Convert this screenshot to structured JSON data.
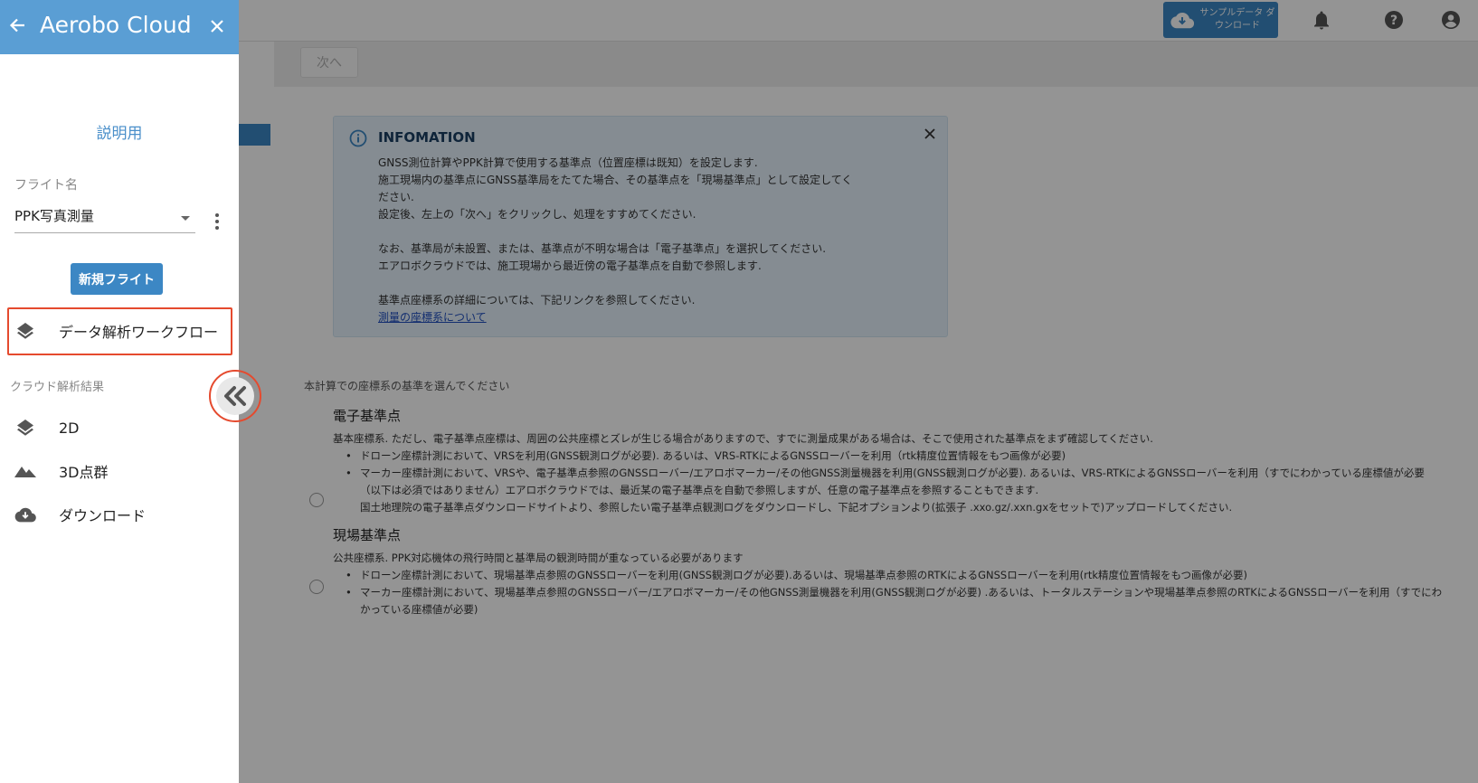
{
  "header": {
    "sample_btn_label": "サンプルデータ ダウンロード",
    "icons": [
      "cloud-download-icon",
      "bell-icon",
      "help-icon",
      "account-icon"
    ]
  },
  "stepbar": {
    "next_label": "次へ"
  },
  "info": {
    "title": "INFOMATION",
    "lines": [
      "GNSS測位計算やPPK計算で使用する基準点（位置座標は既知）を設定します.",
      "施工現場内の基準点にGNSS基準局をたてた場合、その基準点を「現場基準点」として設定してく",
      "ださい.",
      "設定後、左上の「次へ」をクリックし、処理をすすめてください.",
      "なお、基準局が未設置、または、基準点が不明な場合は「電子基準点」を選択してください.",
      "エアロボクラウドでは、施工現場から最近傍の電子基準点を自動で参照します.",
      "基準点座標系の詳細については、下記リンクを参照してください."
    ],
    "link": "測量の座標系について"
  },
  "section": {
    "prompt": "本計算での座標系の基準を選んでください",
    "option1": {
      "title": "電子基準点",
      "desc": "基本座標系. ただし、電子基準点座標は、周囲の公共座標とズレが生じる場合がありますので、すでに測量成果がある場合は、そこで使用された基準点をまず確認してください.",
      "bullets": [
        "ドローン座標計測において、VRSを利用(GNSS観測ログが必要). あるいは、VRS-RTKによるGNSSローバーを利用（rtk精度位置情報をもつ画像が必要)",
        "マーカー座標計測において、VRSや、電子基準点参照のGNSSローバー/エアロボマーカー/その他GNSS測量機器を利用(GNSS観測ログが必要). あるいは、VRS-RTKによるGNSSローバーを利用（すでにわかっている座標値が必要"
      ],
      "sub1": "（以下は必須ではありません）エアロボクラウドでは、最近某の電子基準点を自動で参照しますが、任意の電子基準点を参照することもできます.",
      "sub2": "国土地理院の電子基準点ダウンロードサイトより、参照したい電子基準点観測ログをダウンロードし、下記オプションより(拡張子 .xxo.gz/.xxn.gxをセットで)アップロードしてください."
    },
    "option2": {
      "title": "現場基準点",
      "desc": "公共座標系. PPK対応機体の飛行時間と基準局の観測時間が重なっている必要があります",
      "bullets": [
        "ドローン座標計測において、現場基準点参照のGNSSローバーを利用(GNSS観測ログが必要).あるいは、現場基準点参照のRTKによるGNSSローバーを利用(rtk精度位置情報をもつ画像が必要)",
        "マーカー座標計測において、現場基準点参照のGNSSローバー/エアロボマーカー/その他GNSS測量機器を利用(GNSS観測ログが必要) .あるいは、トータルステーションや現場基準点参照のRTKによるGNSSローバーを利用（すでにわかっている座標値が必要)"
      ]
    }
  },
  "drawer": {
    "title": "Aerobo Cloud",
    "project_name": "説明用",
    "flight_label": "フライト名",
    "flight_value": "PPK写真測量",
    "new_flight_label": "新規フライト",
    "workflow_label": "データ解析ワークフロー",
    "results_label": "クラウド解析結果",
    "item_2d": "2D",
    "item_3d": "3D点群",
    "item_download": "ダウンロード"
  },
  "colors": {
    "accent": "#3c87c4",
    "drawer_header": "#5a9ed4",
    "highlight": "#e54a2e"
  }
}
